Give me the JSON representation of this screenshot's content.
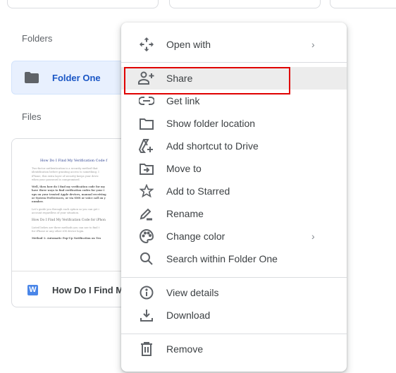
{
  "sections": {
    "folders_label": "Folders",
    "files_label": "Files"
  },
  "folders": [
    {
      "name": "Folder One",
      "icon": "folder-icon"
    }
  ],
  "files": [
    {
      "name": "How Do I Find My",
      "type_badge": "W",
      "type_icon": "word-doc-icon",
      "thumbnail": {
        "title": "How Do I Find My Verification Code f",
        "lines": [
          "Two-factor authentication is a security method that",
          "identification before granting access to something. I",
          "iPhone, this extra layer of security keeps your devic",
          "when your password is compromised.",
          "Well, then how do I find my verification code for my",
          "have three ways to find verification codes for your i",
          "ups on your trusted Apple devices, manual receiving",
          "or System Preferences, or via SMS or voice call on y",
          "number.",
          "Let's guide you through each option so you can get i",
          "account regardless of your situation.",
          "How Do I Find My Verification Code for iPhon",
          "Listed below are three methods you can use to find t",
          "for iPhone or any other iOS device login.",
          "Method 1: Automatic Pop-Up Notification on Tru"
        ]
      }
    }
  ],
  "context_menu": {
    "items": [
      {
        "label": "Open with",
        "icon": "open-with-icon",
        "submenu": true
      },
      {
        "label": "Share",
        "icon": "person-add-icon",
        "highlighted": true
      },
      {
        "label": "Get link",
        "icon": "link-icon"
      },
      {
        "label": "Show folder location",
        "icon": "folder-outline-icon"
      },
      {
        "label": "Add shortcut to Drive",
        "icon": "add-shortcut-icon"
      },
      {
        "label": "Move to",
        "icon": "move-to-icon"
      },
      {
        "label": "Add to Starred",
        "icon": "star-icon"
      },
      {
        "label": "Rename",
        "icon": "pencil-icon"
      },
      {
        "label": "Change color",
        "icon": "palette-icon",
        "submenu": true
      },
      {
        "label": "Search within Folder One",
        "icon": "search-icon"
      },
      {
        "label": "View details",
        "icon": "info-icon"
      },
      {
        "label": "Download",
        "icon": "download-icon"
      },
      {
        "label": "Remove",
        "icon": "trash-icon"
      }
    ],
    "submenu_glyph": "›"
  },
  "colors": {
    "highlight_outline": "#e00000",
    "folder_selected_bg": "#e8f0fe",
    "folder_text": "#1a56c5",
    "word_badge": "#4a86e8"
  }
}
